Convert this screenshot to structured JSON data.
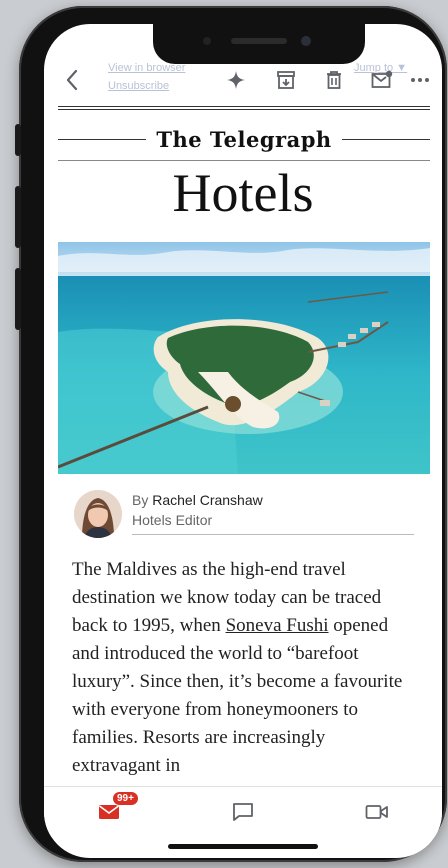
{
  "toolbar": {
    "faded_link_1": "View in browser",
    "faded_link_2": "Unsubscribe",
    "faded_link_3": "Jump to ▼"
  },
  "email": {
    "masthead": "The Telegraph",
    "section_title": "Hotels",
    "byline_prefix": "By",
    "author_name": "Rachel Cranshaw",
    "author_role": "Hotels Editor",
    "body": {
      "part1": "The Maldives as the high-end travel destination we know today can be traced back to 1995, when ",
      "link": "Soneva Fushi",
      "part2": " opened and introduced the world to “barefoot luxury”. Since then, it’s become a favourite with everyone from honeymooners to families. Resorts are increasingly extravagant in"
    }
  },
  "tabbar": {
    "mail_badge": "99+"
  },
  "colors": {
    "accent_red": "#d93025",
    "icon_gray": "#5f6368",
    "water": "#2fb7c9"
  }
}
